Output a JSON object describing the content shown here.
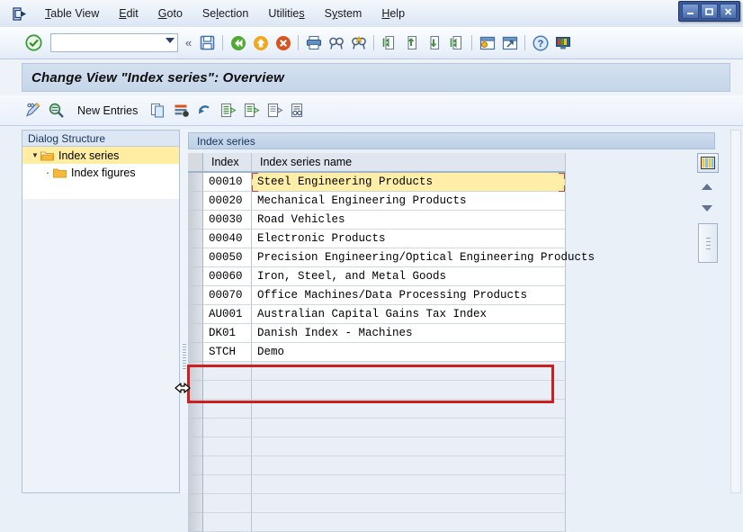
{
  "window": {
    "buttons": [
      {
        "name": "minimize",
        "glyph": "_"
      },
      {
        "name": "maximize",
        "glyph": "❐"
      },
      {
        "name": "close",
        "glyph": "✕"
      }
    ]
  },
  "menubar": {
    "leading_icon": "exit-arrow-icon",
    "items": [
      {
        "label": "Table View",
        "accel": "T"
      },
      {
        "label": "Edit",
        "accel": "E"
      },
      {
        "label": "Goto",
        "accel": "G"
      },
      {
        "label": "Selection",
        "accel": "l"
      },
      {
        "label": "Utilities",
        "accel": "s"
      },
      {
        "label": "System",
        "accel": "y"
      },
      {
        "label": "Help",
        "accel": "H"
      }
    ]
  },
  "toolbar": {
    "enter_icon": "green-check-enter-icon",
    "command_field": {
      "value": "",
      "placeholder": ""
    },
    "expand_chevron": "«",
    "icons": [
      {
        "name": "save-icon",
        "title": "Save"
      },
      {
        "name": "back-icon",
        "title": "Back"
      },
      {
        "name": "exit-icon",
        "title": "Exit"
      },
      {
        "name": "cancel-icon",
        "title": "Cancel"
      },
      {
        "name": "print-icon",
        "title": "Print"
      },
      {
        "name": "find-icon",
        "title": "Find"
      },
      {
        "name": "find-next-icon",
        "title": "Find Next"
      },
      {
        "name": "first-page-icon",
        "title": "First Page"
      },
      {
        "name": "previous-page-icon",
        "title": "Previous Page"
      },
      {
        "name": "next-page-icon",
        "title": "Next Page"
      },
      {
        "name": "last-page-icon",
        "title": "Last Page"
      },
      {
        "name": "create-session-icon",
        "title": "Create New Session"
      },
      {
        "name": "create-shortcut-icon",
        "title": "Create Shortcut"
      },
      {
        "name": "help-icon",
        "title": "Help"
      },
      {
        "name": "customize-layout-icon",
        "title": "Customize Local Layout"
      }
    ]
  },
  "title": {
    "text": "Change View \"Index series\": Overview"
  },
  "app_toolbar": {
    "icons_left": [
      {
        "name": "display-change-icon",
        "title": "Display/Change"
      },
      {
        "name": "details-icon",
        "title": "Details"
      }
    ],
    "new_entries_label": "New Entries",
    "icons_right": [
      {
        "name": "copy-as-icon",
        "title": "Copy As..."
      },
      {
        "name": "delete-icon",
        "title": "Delete"
      },
      {
        "name": "undo-icon",
        "title": "Undo Change"
      },
      {
        "name": "select-all-icon",
        "title": "Select All"
      },
      {
        "name": "select-block-icon",
        "title": "Select Block"
      },
      {
        "name": "deselect-all-icon",
        "title": "Deselect All"
      },
      {
        "name": "variable-list-icon",
        "title": "Variable List"
      }
    ]
  },
  "dialog_structure": {
    "header": "Dialog Structure",
    "nodes": [
      {
        "label": "Index series",
        "level": 0,
        "selected": true,
        "expanded": true,
        "folder": "open-folder-icon"
      },
      {
        "label": "Index figures",
        "level": 1,
        "selected": false,
        "expanded": false,
        "folder": "closed-folder-icon"
      }
    ]
  },
  "grid": {
    "title": "Index series",
    "columns": [
      "Index",
      "Index series name"
    ],
    "rows": [
      {
        "index": "00010",
        "name": "Steel Engineering Products",
        "focused": true
      },
      {
        "index": "00020",
        "name": "Mechanical Engineering Products",
        "focused": false
      },
      {
        "index": "00030",
        "name": "Road Vehicles",
        "focused": false
      },
      {
        "index": "00040",
        "name": "Electronic Products",
        "focused": false
      },
      {
        "index": "00050",
        "name": "Precision Engineering/Optical Engineering Products",
        "focused": false
      },
      {
        "index": "00060",
        "name": "Iron, Steel, and Metal Goods",
        "focused": false
      },
      {
        "index": "00070",
        "name": "Office Machines/Data Processing Products",
        "focused": false
      },
      {
        "index": "AU001",
        "name": "Australian Capital Gains Tax Index",
        "focused": false
      },
      {
        "index": "DK01",
        "name": "Danish Index - Machines",
        "focused": false
      },
      {
        "index": "STCH",
        "name": "Demo",
        "focused": false
      }
    ],
    "empty_row_count": 9,
    "side_controls": [
      {
        "name": "column-config-icon",
        "title": "Configuration"
      },
      {
        "name": "scroll-up-icon",
        "title": "Scroll Up"
      },
      {
        "name": "scroll-down-icon",
        "title": "Scroll Down"
      },
      {
        "name": "scrollbar-thumb",
        "title": "Vertical Scrollbar"
      }
    ]
  },
  "annotation": {
    "highlight_color": "#cc2020",
    "target_row_index": "STCH"
  },
  "cursor": {
    "name": "column-resize-cursor"
  },
  "colors": {
    "selection_yellow": "#ffeda1",
    "focus_red": "#c94040",
    "panel_blue": "#eef3fa"
  }
}
